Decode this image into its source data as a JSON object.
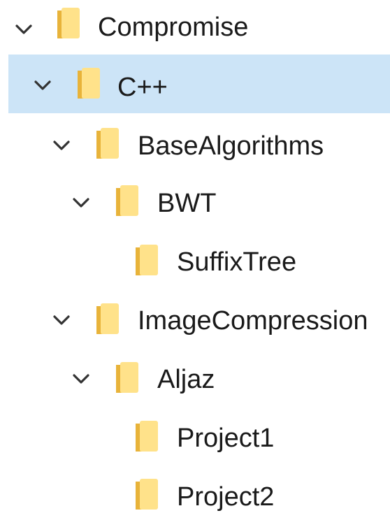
{
  "tree": {
    "selected_index": 1,
    "items": [
      {
        "label": "Compromise",
        "level": 0,
        "expanded": true,
        "icon": "folder-icon"
      },
      {
        "label": "C++",
        "level": 1,
        "expanded": true,
        "icon": "folder-icon"
      },
      {
        "label": "BaseAlgorithms",
        "level": 2,
        "expanded": true,
        "icon": "folder-icon"
      },
      {
        "label": "BWT",
        "level": 3,
        "expanded": true,
        "icon": "folder-icon"
      },
      {
        "label": "SuffixTree",
        "level": 4,
        "expanded": null,
        "icon": "folder-icon"
      },
      {
        "label": "ImageCompression",
        "level": 2,
        "expanded": true,
        "icon": "folder-icon"
      },
      {
        "label": "Aljaz",
        "level": 3,
        "expanded": true,
        "icon": "folder-icon"
      },
      {
        "label": "Project1",
        "level": 4,
        "expanded": null,
        "icon": "folder-icon"
      },
      {
        "label": "Project2",
        "level": 4,
        "expanded": null,
        "icon": "folder-icon"
      }
    ]
  },
  "colors": {
    "selection": "#cce4f7",
    "folder_light": "#ffe28a",
    "folder_dark": "#f5c242",
    "chevron": "#333333",
    "text": "#1a1a1a"
  }
}
